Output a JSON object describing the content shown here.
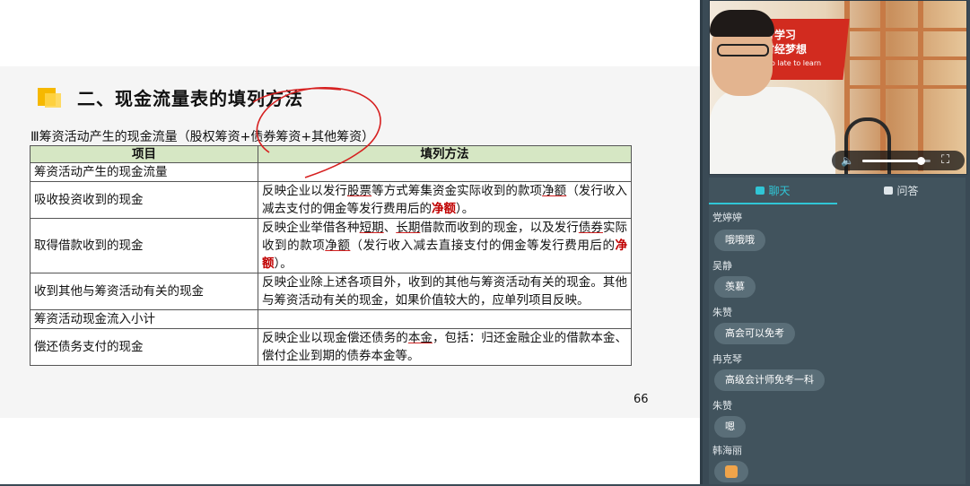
{
  "slide": {
    "title": "二、现金流量表的填列方法",
    "subheading": "Ⅲ筹资活动产生的现金流量（股权筹资+债券筹资+其他筹资）",
    "table": {
      "headers": [
        "项目",
        "填列方法"
      ],
      "rows": [
        {
          "item": "筹资活动产生的现金流量",
          "method": ""
        },
        {
          "item": "吸收投资收到的现金",
          "method_parts": [
            "反映企业以发行",
            "股票",
            "等方式筹集资金实际收到的款项",
            "净额",
            "（发行收入减去支付的佣金等发行费用后的",
            "净额",
            "）。"
          ]
        },
        {
          "item": "取得借款收到的现金",
          "method_parts": [
            "反映企业举借各种",
            "短期",
            "、",
            "长期",
            "借款而收到的现金，以及发行",
            "债券",
            "实际收到的款项",
            "净额",
            "（发行收入减去直接支付的佣金等发行费用后的",
            "净额",
            "）。"
          ]
        },
        {
          "item": "收到其他与筹资活动有关的现金",
          "method": "反映企业除上述各项目外，收到的其他与筹资活动有关的现金。其他与筹资活动有关的现金，如果价值较大的，应单列项目反映。"
        },
        {
          "item": "筹资活动现金流入小计",
          "method": ""
        },
        {
          "item": "偿还债务支付的现金",
          "method_parts": [
            "反映企业以现金偿还债务的",
            "本金",
            "，包括：归还金融企业的借款本金、偿付企业到期的债券本金等。"
          ]
        }
      ]
    },
    "page_number": "66"
  },
  "video": {
    "banner_line1": "身学习",
    "banner_line2": "财经梦想",
    "banner_line3": "too late to learn",
    "volume_level": 0.85
  },
  "chat": {
    "tabs": {
      "chat": "聊天",
      "qa": "问答"
    },
    "active_tab": "chat",
    "messages": [
      {
        "name": "党婷婷",
        "text": "哦哦哦"
      },
      {
        "name": "吴静",
        "text": "羡慕"
      },
      {
        "name": "朱赞",
        "text": "高会可以免考"
      },
      {
        "name": "冉克琴",
        "text": "高级会计师免考一科"
      },
      {
        "name": "朱赞",
        "text": "嗯"
      },
      {
        "name": "韩海丽",
        "text": "",
        "emoji": "thumbs-up"
      }
    ]
  },
  "colors": {
    "accent": "#30c6d6",
    "highlight_red": "#c00000",
    "table_header": "#d6e7c4",
    "title_marker": "#f6b800"
  }
}
